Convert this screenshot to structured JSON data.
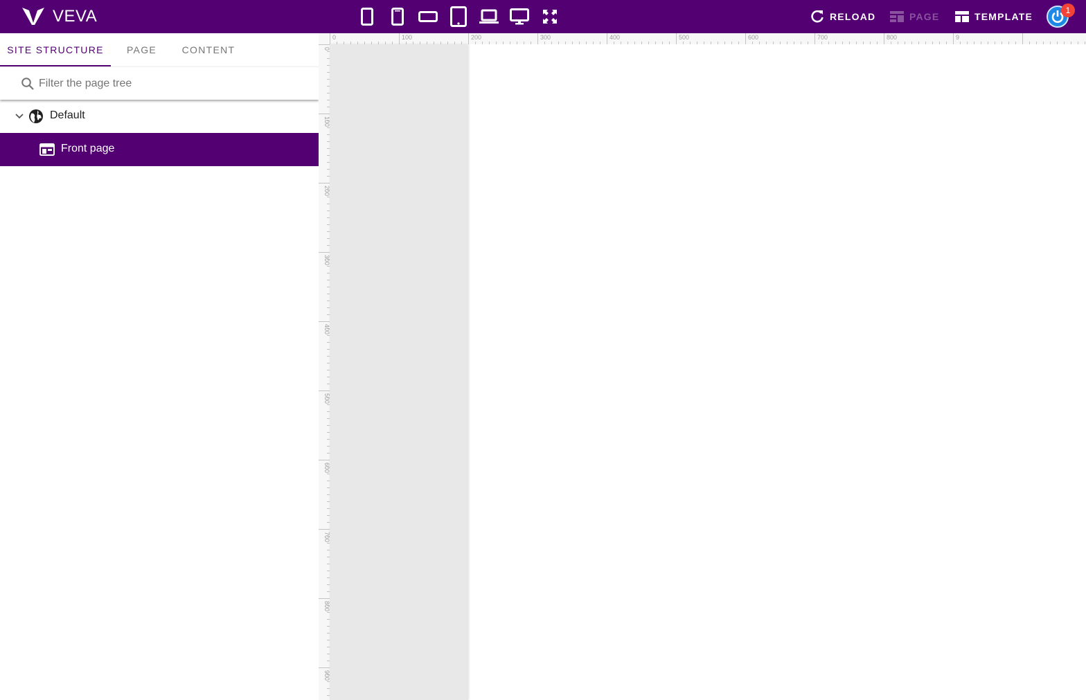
{
  "app": {
    "name": "VEVA"
  },
  "colors": {
    "brand": "#520072",
    "avatar": "#1e88e5",
    "badge": "#f44336"
  },
  "device_buttons": [
    {
      "name": "small-phone-icon"
    },
    {
      "name": "phone-icon"
    },
    {
      "name": "phone-landscape-icon"
    },
    {
      "name": "tablet-icon"
    },
    {
      "name": "laptop-icon"
    },
    {
      "name": "desktop-icon"
    },
    {
      "name": "fullscreen-icon"
    }
  ],
  "toolbar": {
    "reload_label": "RELOAD",
    "page_label": "PAGE",
    "template_label": "TEMPLATE",
    "notification_count": "1"
  },
  "tabs": [
    {
      "label": "SITE STRUCTURE",
      "active": true
    },
    {
      "label": "PAGE",
      "active": false
    },
    {
      "label": "CONTENT",
      "active": false
    }
  ],
  "filter": {
    "placeholder": "Filter the page tree",
    "value": ""
  },
  "tree": [
    {
      "label": "Default",
      "icon": "globe-icon",
      "expanded": true,
      "selected": false
    },
    {
      "label": "Front page",
      "icon": "web-page-icon",
      "selected": true
    }
  ],
  "ruler": {
    "h_labels": [
      "0",
      "100",
      "200",
      "300",
      "400",
      "500",
      "600",
      "700",
      "800",
      "9"
    ],
    "v_labels": [
      "0",
      "100",
      "200",
      "300",
      "400",
      "500",
      "600",
      "700",
      "800",
      "900"
    ]
  }
}
